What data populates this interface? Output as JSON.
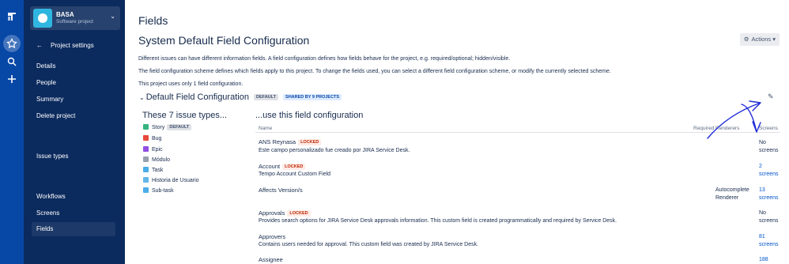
{
  "project": {
    "name": "BASA",
    "type": "Software project"
  },
  "sidebar": {
    "back_label": "Project settings",
    "items": [
      {
        "label": "Details",
        "selected": false
      },
      {
        "label": "People",
        "selected": false
      },
      {
        "label": "Summary",
        "selected": false
      },
      {
        "label": "Delete project",
        "selected": false
      },
      {
        "label": "Issue types",
        "selected": false
      },
      {
        "label": "Workflows",
        "selected": false
      },
      {
        "label": "Screens",
        "selected": false
      },
      {
        "label": "Fields",
        "selected": true
      }
    ]
  },
  "page": {
    "title": "Fields",
    "subtitle": "System Default Field Configuration",
    "actions_label": "Actions",
    "desc1": "Different issues can have different information fields. A field configuration defines how fields behave for the project, e.g. required/optional; hidden/visible.",
    "desc2": "The field configuration scheme defines which fields apply to this project. To change the fields used, you can select a different field configuration scheme, or modify the currently selected scheme.",
    "desc3": "This project uses only 1 field configuration."
  },
  "config": {
    "name": "Default Field Configuration",
    "badge_default": "DEFAULT",
    "badge_shared": "SHARED BY 9 PROJECTS",
    "types_title": "These 7 issue types...",
    "fields_title": "...use this field configuration"
  },
  "issue_types": [
    {
      "name": "Story",
      "badge": "DEFAULT",
      "color": "#36b37e",
      "icon": "story-icon"
    },
    {
      "name": "Bug",
      "badge": "",
      "color": "#e5493a",
      "icon": "bug-icon"
    },
    {
      "name": "Epic",
      "badge": "",
      "color": "#904ee2",
      "icon": "epic-icon"
    },
    {
      "name": "Módulo",
      "badge": "",
      "color": "#97a0af",
      "icon": "module-icon"
    },
    {
      "name": "Task",
      "badge": "",
      "color": "#4bade8",
      "icon": "task-icon"
    },
    {
      "name": "Historia de Usuario",
      "badge": "",
      "color": "#62b6e8",
      "icon": "user-story-icon"
    },
    {
      "name": "Sub-task",
      "badge": "",
      "color": "#4bade8",
      "icon": "subtask-icon"
    }
  ],
  "table": {
    "headers": {
      "name": "Name",
      "required": "Required",
      "renderers": "Renderers",
      "screens": "Screens"
    },
    "locked_label": "LOCKED",
    "rows": [
      {
        "name": "ANS Reynasa",
        "locked": true,
        "desc": "Este campo personalizado fue creado por JIRA Service Desk.",
        "renderer": "",
        "screens_1": "No",
        "screens_2": "screens",
        "is_link": false
      },
      {
        "name": "Account",
        "locked": true,
        "desc": "Tempo Account Custom Field",
        "renderer": "",
        "screens_1": "2",
        "screens_2": "screens",
        "is_link": true
      },
      {
        "name": "Affects Version/s",
        "locked": false,
        "desc": "",
        "renderer_1": "Autocomplete",
        "renderer_2": "Renderer",
        "screens_1": "13",
        "screens_2": "screens",
        "is_link": true
      },
      {
        "name": "Approvals",
        "locked": true,
        "desc": "Provides search options for JIRA Service Desk approvals information. This custom field is created programmatically and required by Service Desk.",
        "renderer": "",
        "screens_1": "No",
        "screens_2": "screens",
        "is_link": false
      },
      {
        "name": "Approvers",
        "locked": false,
        "desc": "Contains users needed for approval. This custom field was created by JIRA Service Desk.",
        "renderer": "",
        "screens_1": "81",
        "screens_2": "screens",
        "is_link": true
      },
      {
        "name": "Assignee",
        "locked": false,
        "desc": "",
        "renderer": "",
        "screens_1": "188",
        "screens_2": "",
        "is_link": true
      }
    ]
  },
  "colors": {
    "global_nav": "#0747a6",
    "sidebar": "#0b2a5e",
    "link": "#0052cc",
    "annotation": "#1f2bd6"
  }
}
